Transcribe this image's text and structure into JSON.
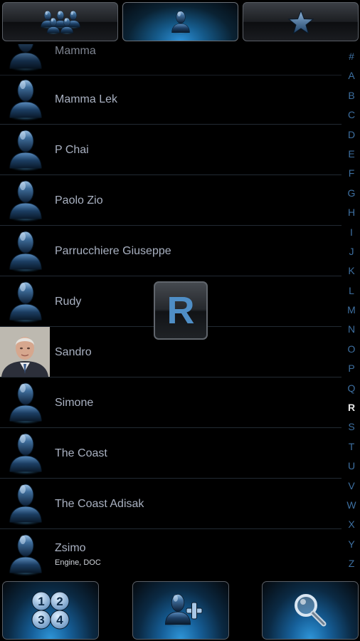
{
  "tabs": [
    {
      "icon": "group-icon"
    },
    {
      "icon": "contact-person-icon",
      "active": true
    },
    {
      "icon": "star-icon"
    }
  ],
  "contacts": [
    {
      "name": "Mamma",
      "avatar": "person-silhouette-icon"
    },
    {
      "name": "Mamma Lek",
      "avatar": "person-silhouette-icon"
    },
    {
      "name": "P Chai",
      "avatar": "person-silhouette-icon"
    },
    {
      "name": "Paolo Zio",
      "avatar": "person-silhouette-icon"
    },
    {
      "name": "Parrucchiere Giuseppe",
      "avatar": "person-silhouette-icon"
    },
    {
      "name": "Rudy",
      "avatar": "person-silhouette-icon"
    },
    {
      "name": "Sandro",
      "avatar": "contact-photo"
    },
    {
      "name": "Simone",
      "avatar": "person-silhouette-icon"
    },
    {
      "name": "The Coast",
      "avatar": "person-silhouette-icon"
    },
    {
      "name": "The Coast Adisak",
      "avatar": "person-silhouette-icon"
    },
    {
      "name": "Zsimo",
      "subtitle": "Engine, DOC",
      "avatar": "person-silhouette-icon"
    }
  ],
  "index_letters": [
    "#",
    "A",
    "B",
    "C",
    "D",
    "E",
    "F",
    "G",
    "H",
    "I",
    "J",
    "K",
    "L",
    "M",
    "N",
    "O",
    "P",
    "Q",
    "R",
    "S",
    "T",
    "U",
    "V",
    "W",
    "X",
    "Y",
    "Z"
  ],
  "index_current": "R",
  "overlay_letter": "R",
  "bottom_buttons": [
    {
      "icon": "dialpad-1234-icon"
    },
    {
      "icon": "add-contact-icon"
    },
    {
      "icon": "search-magnifier-icon"
    }
  ],
  "colors": {
    "accent_blue": "#2c8fd6",
    "index_letter": "#3d6fa0",
    "name_text": "#a9b1c1",
    "overlay_letter": "#4f8ec6"
  }
}
